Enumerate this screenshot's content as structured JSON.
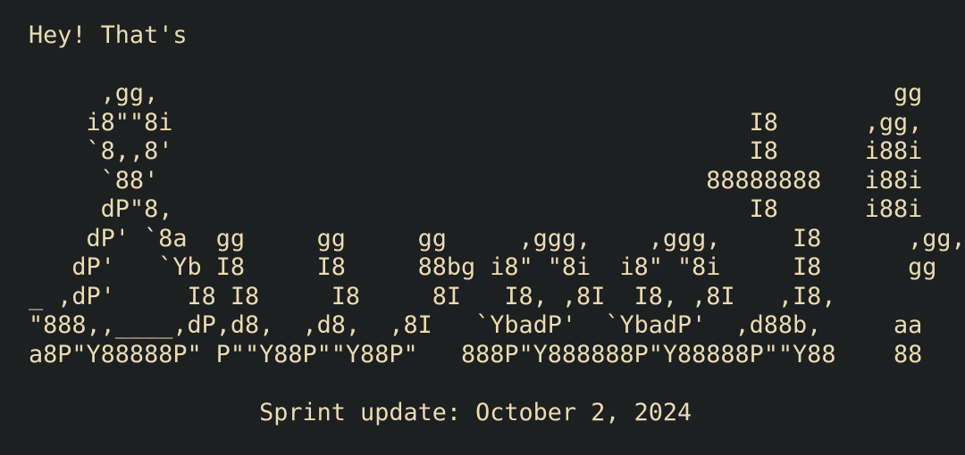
{
  "terminal": {
    "colors": {
      "background": "#1d2021",
      "foreground": "#ebdbb2"
    },
    "lines": [
      "Hey! That's",
      "",
      "     ,gg,                                                   gg",
      "    i8\"\"8i                                        I8      ,gg,",
      "    `8,,8'                                        I8      i88i",
      "     `88'                                      88888888   i88i",
      "     dP\"8,                                        I8      i88i",
      "    dP' `8a  gg     gg     gg     ,ggg,    ,ggg,     I8      ,gg,",
      "   dP'   `Yb I8     I8     88bg i8\" \"8i  i8\" \"8i     I8      gg",
      "_ ,dP'     I8 I8     I8     8I   I8, ,8I  I8, ,8I   ,I8,",
      "\"888,,____,dP,d8,  ,d8,  ,8I   `YbadP'  `YbadP'  ,d88b,     aa",
      "a8P\"Y88888P\" P\"\"Y88P\"\"Y88P\"   888P\"Y888888P\"Y88888P\"\"Y88    88",
      "",
      "                Sprint update: October 2, 2024"
    ]
  }
}
